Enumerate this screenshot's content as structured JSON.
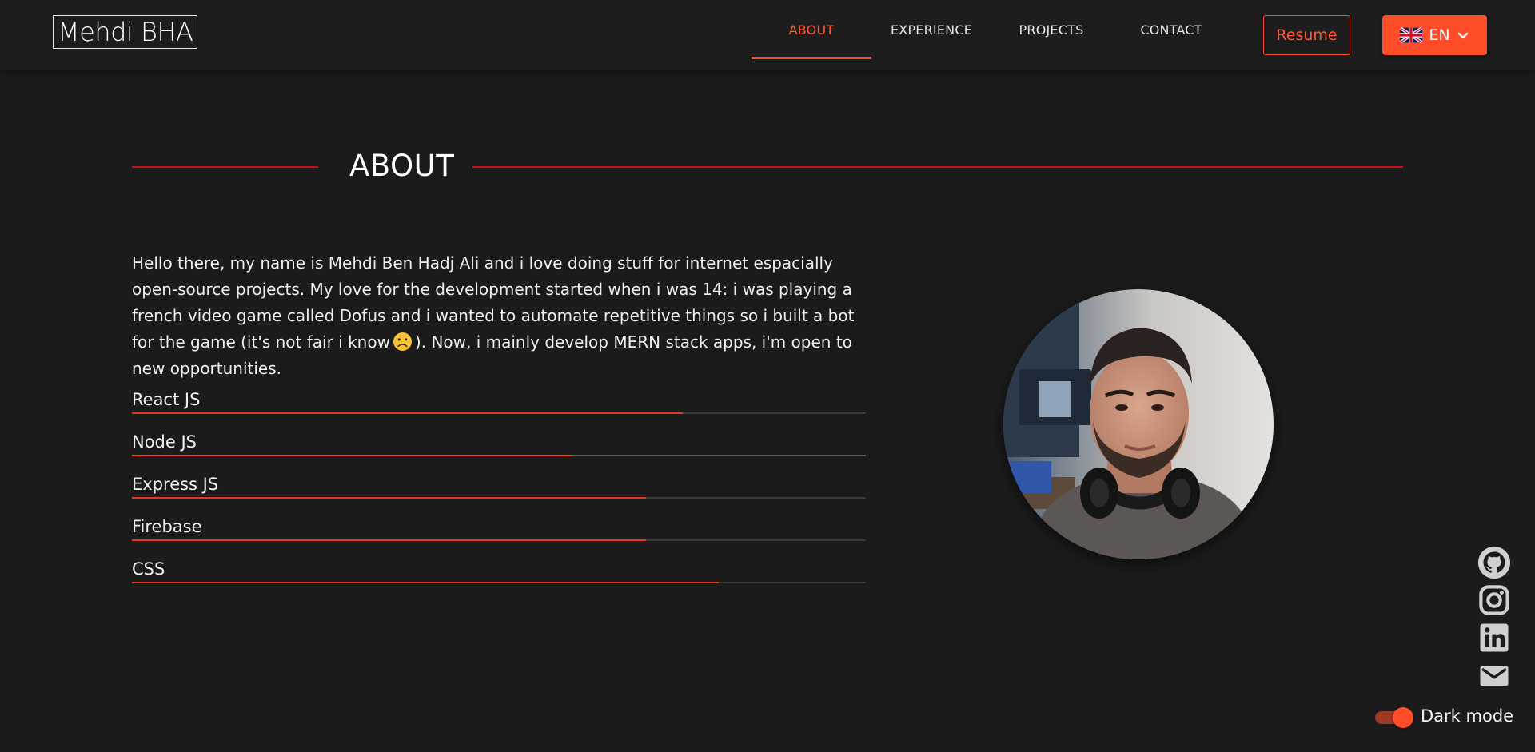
{
  "header": {
    "logo": "Mehdi BHA",
    "nav": [
      {
        "label": "ABOUT",
        "active": true
      },
      {
        "label": "EXPERIENCE",
        "active": false
      },
      {
        "label": "PROJECTS",
        "active": false
      },
      {
        "label": "CONTACT",
        "active": false
      }
    ],
    "resume_label": "Resume",
    "language": {
      "selected": "EN",
      "flag_icon": "uk-flag-icon",
      "chevron_icon": "chevron-down-icon"
    }
  },
  "about": {
    "title": "ABOUT",
    "intro_before_emoji": "Hello there, my name is Mehdi Ben Hadj Ali and i love doing stuff for internet espacially open-source projects. My love for the development started when i was 14: i was playing a french video game called Dofus and i wanted to automate repetitive things so i built a bot for the game (it's not fair i know",
    "intro_after_emoji": "). Now, i mainly develop MERN stack apps, i'm open to new opportunities.",
    "emoji_icon": "sad-face-emoji-icon",
    "skills": [
      {
        "name": "React JS",
        "level": 0.75
      },
      {
        "name": "Node JS",
        "level": 0.6
      },
      {
        "name": "Express JS",
        "level": 0.7
      },
      {
        "name": "Firebase",
        "level": 0.7
      },
      {
        "name": "CSS",
        "level": 0.8
      }
    ],
    "photo_icon": "profile-photo"
  },
  "social": [
    "github-icon",
    "instagram-icon",
    "linkedin-icon",
    "email-icon"
  ],
  "theme": {
    "toggle_label": "Dark mode",
    "dark_mode": true
  },
  "colors": {
    "accent": "#ff4d2a",
    "title_line": "#c4121a",
    "background": "#1b1b1b"
  }
}
